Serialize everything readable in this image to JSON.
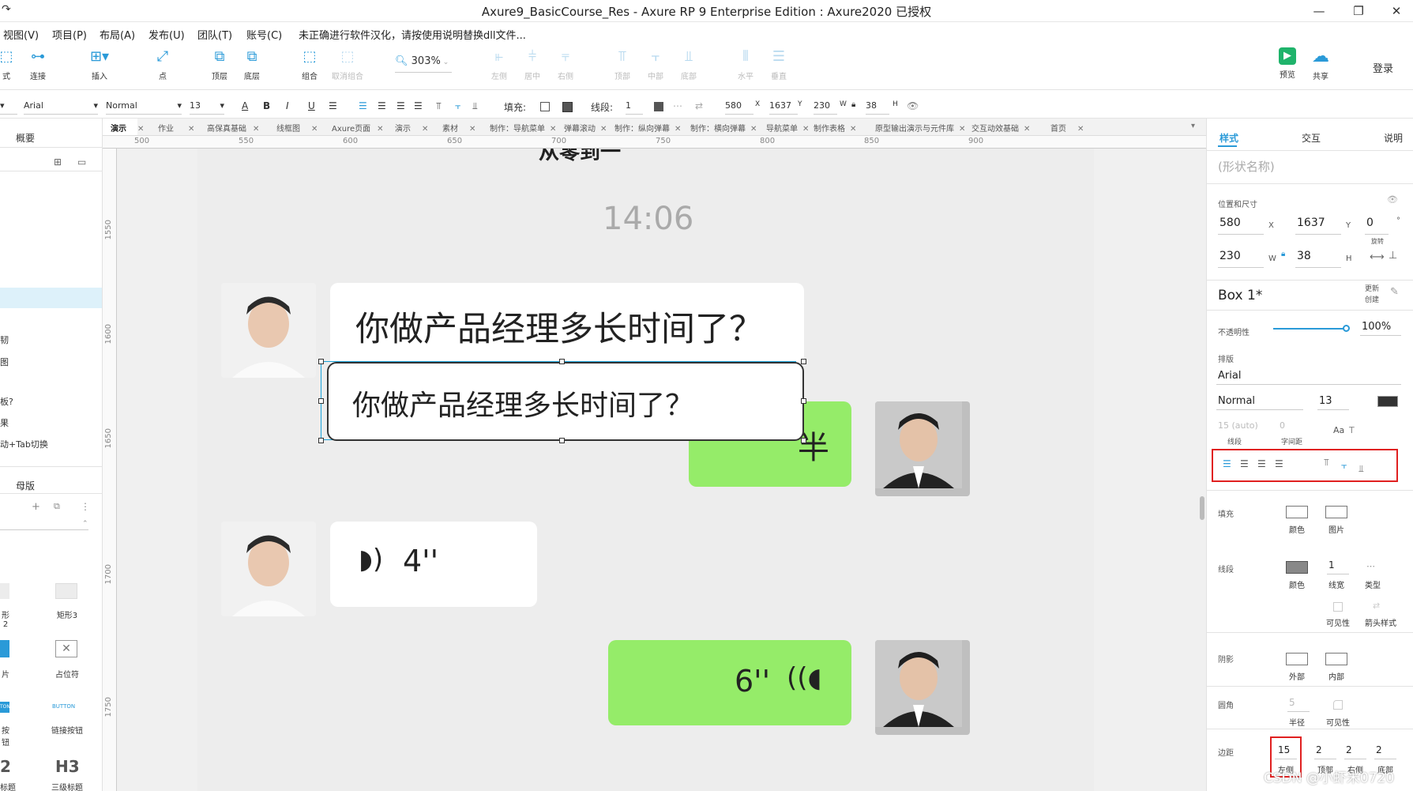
{
  "window": {
    "title": "Axure9_BasicCourse_Res - Axure RP 9 Enterprise Edition : Axure2020 已授权",
    "minimize": "—",
    "maximize": "❐",
    "close": "✕"
  },
  "menu": [
    "视图(V)",
    "项目(P)",
    "布局(A)",
    "发布(U)",
    "团队(T)",
    "账号(C)"
  ],
  "menu_notice": "未正确进行软件汉化，请按使用说明替换dll文件...",
  "toolbar": {
    "items": [
      {
        "label": "连接",
        "icon": "connect-icon"
      },
      {
        "label": "插入",
        "icon": "insert-icon"
      },
      {
        "label": "点",
        "icon": "point-icon"
      },
      {
        "label": "顶层",
        "icon": "bring-front-icon"
      },
      {
        "label": "底层",
        "icon": "send-back-icon"
      },
      {
        "label": "组合",
        "icon": "group-icon"
      },
      {
        "label": "取消组合",
        "icon": "ungroup-icon"
      },
      {
        "label": "左侧",
        "icon": "align-left-icon"
      },
      {
        "label": "居中",
        "icon": "align-center-icon"
      },
      {
        "label": "右侧",
        "icon": "align-right-icon"
      },
      {
        "label": "顶部",
        "icon": "align-top-icon"
      },
      {
        "label": "中部",
        "icon": "align-middle-icon"
      },
      {
        "label": "底部",
        "icon": "align-bottom-icon"
      },
      {
        "label": "水平",
        "icon": "distribute-h-icon"
      },
      {
        "label": "垂直",
        "icon": "distribute-v-icon"
      },
      {
        "label": "预览",
        "icon": "preview-icon"
      },
      {
        "label": "共享",
        "icon": "share-cloud-icon"
      }
    ],
    "zoom": "303%",
    "login": "登录"
  },
  "format": {
    "font": "Arial",
    "weight": "Normal",
    "size": "13",
    "fill_label": "填充:",
    "stroke_label": "线段:",
    "stroke_value": "1",
    "x": "580",
    "x_unit": "X",
    "y": "1637",
    "y_unit": "Y",
    "w": "230",
    "w_unit": "W",
    "h": "38",
    "h_unit": "H"
  },
  "left": {
    "overview_title": "概要",
    "items": [
      "韧",
      "图",
      "板?",
      "果",
      "动+Tab切换"
    ],
    "masters_title": "母版",
    "widgets": [
      {
        "label": "形2"
      },
      {
        "label": "矩形3"
      },
      {
        "label": "片"
      },
      {
        "label": "占位符"
      },
      {
        "label": "按钮"
      },
      {
        "label": "链接按钮"
      },
      {
        "label": "2"
      },
      {
        "label": "H3"
      },
      {
        "label": "标题"
      },
      {
        "label": "三级标题"
      }
    ],
    "button_text": "BUTTON",
    "ton_text": "TON"
  },
  "tabs": [
    "演示",
    "作业",
    "高保真基础",
    "线框图",
    "Axure页面",
    "演示",
    "素材",
    "制作：导航菜单",
    "弹幕滚动",
    "制作：纵向弹幕",
    "制作：横向弹幕",
    "导航菜单",
    "制作表格",
    "原型输出演示与元件库",
    "交互动效基础",
    "首页"
  ],
  "ruler": {
    "h": [
      "500",
      "550",
      "600",
      "650",
      "700",
      "750",
      "800",
      "850",
      "900"
    ],
    "v": [
      "1550",
      "1600",
      "1650",
      "1700",
      "1750"
    ]
  },
  "chat": {
    "header": "从零到一",
    "time": "14:06",
    "msg1": "你做产品经理多长时间了？",
    "selected": "你做产品经理多长时间了？",
    "green1_tail": "半",
    "voice1": "4''",
    "voice2": "6''"
  },
  "right": {
    "tabs": [
      "样式",
      "交互",
      "说明"
    ],
    "shape_name_placeholder": "(形状名称)",
    "pos_title": "位置和尺寸",
    "x": "580",
    "x_lbl": "X",
    "y": "1637",
    "y_lbl": "Y",
    "rot": "0",
    "rot_unit": "°",
    "rot_lbl": "旋转",
    "w": "230",
    "w_lbl": "W",
    "h": "38",
    "h_lbl": "H",
    "style_name": "Box 1*",
    "update": "更新",
    "create": "创建",
    "opacity_lbl": "不透明性",
    "opacity": "100%",
    "typography_lbl": "排版",
    "font": "Arial",
    "weight": "Normal",
    "size": "13",
    "line_spacing": "15 (auto)",
    "line_spacing_lbl": "线段",
    "char_spacing": "0",
    "char_spacing_lbl": "字间距",
    "fill_lbl": "填充",
    "fill_color": "颜色",
    "fill_image": "图片",
    "stroke_lbl": "线段",
    "stroke_color": "颜色",
    "stroke_width": "1",
    "stroke_width_lbl": "线宽",
    "stroke_type": "类型",
    "visibility": "可见性",
    "arrow_style": "箭头样式",
    "shadow_lbl": "阴影",
    "shadow_outer": "外部",
    "shadow_inner": "内部",
    "corner_lbl": "圆角",
    "corner_radius": "5",
    "corner_radius_lbl": "半径",
    "corner_vis": "可见性",
    "padding_lbl": "边距",
    "pad_left": "15",
    "pad_left_lbl": "左侧",
    "pad_top": "2",
    "pad_top_lbl": "顶部",
    "pad_right": "2",
    "pad_right_lbl": "右侧",
    "pad_bottom": "2",
    "pad_bottom_lbl": "底部"
  },
  "watermark": "CSDN @小虾米0720",
  "colors": {
    "accent": "#2a9ad8",
    "green": "#95ec69",
    "red": "#e02020"
  }
}
